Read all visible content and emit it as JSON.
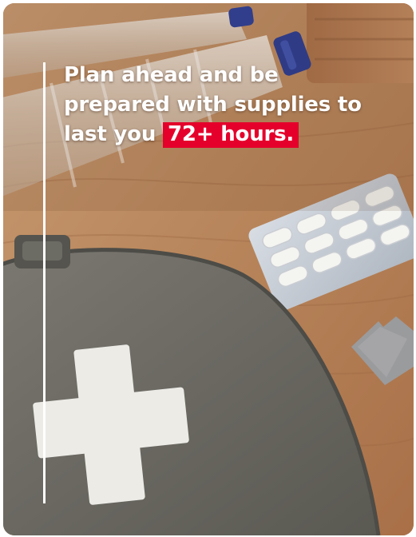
{
  "headline": {
    "line_1": "Plan ahead and be",
    "line_2": "prepared with supplies to",
    "line_3_prefix": "last you",
    "highlight": "72+ hours."
  },
  "colors": {
    "highlight_background": "#e4002b",
    "headline_text": "#ffffff",
    "accent_line": "#ffffff",
    "wood_table": "#b5835a",
    "first_aid_bag": "#6b6a63",
    "cross": "#eceae4"
  },
  "scene_objects": [
    "water-bottles",
    "pill-blister-pack",
    "first-aid-kit",
    "storage-box",
    "metal-tag"
  ]
}
